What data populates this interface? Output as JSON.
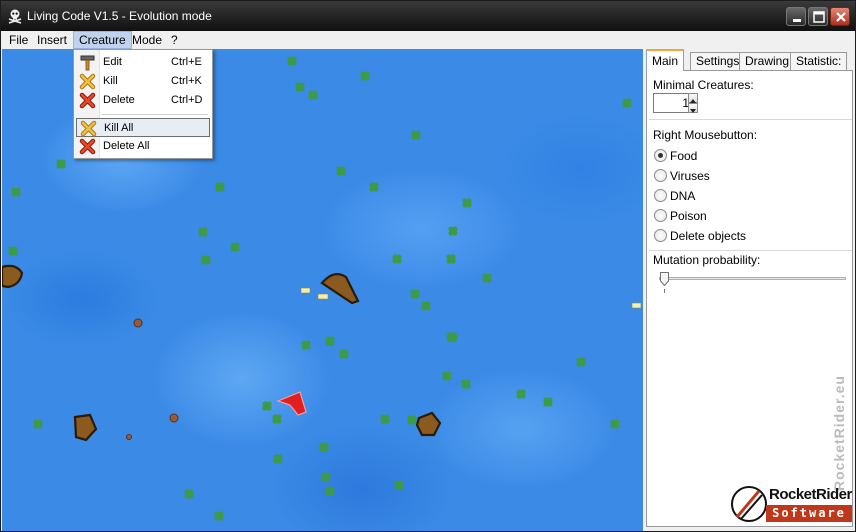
{
  "window": {
    "title": "Living Code V1.5 - Evolution mode",
    "icon": "skull-crossbones-icon"
  },
  "menubar": {
    "items": [
      {
        "label": "File"
      },
      {
        "label": "Insert"
      },
      {
        "label": "Creature",
        "active": true
      },
      {
        "label": "Mode"
      },
      {
        "label": "?"
      }
    ]
  },
  "creature_menu": {
    "items": [
      {
        "icon": "hammer-icon",
        "label": "Edit",
        "shortcut": "Ctrl+E"
      },
      {
        "icon": "kill-icon",
        "label": "Kill",
        "shortcut": "Ctrl+K"
      },
      {
        "icon": "delete-icon",
        "label": "Delete",
        "shortcut": "Ctrl+D"
      },
      {
        "icon": "kill-all-icon",
        "label": "Kill All",
        "shortcut": "",
        "hover": true
      },
      {
        "icon": "delete-all-icon",
        "label": "Delete All",
        "shortcut": ""
      }
    ]
  },
  "panel": {
    "tabs": [
      {
        "label": "Main",
        "selected": true
      },
      {
        "label": "Settings"
      },
      {
        "label": "Drawing"
      },
      {
        "label": "Statistic:"
      }
    ],
    "minimal_creatures_label": "Minimal Creatures:",
    "minimal_creatures_value": "1",
    "right_mouse_label": "Right Mousebutton:",
    "right_mouse_options": [
      {
        "label": "Food",
        "checked": true
      },
      {
        "label": "Viruses",
        "checked": false
      },
      {
        "label": "DNA",
        "checked": false
      },
      {
        "label": "Poison",
        "checked": false
      },
      {
        "label": "Delete objects",
        "checked": false
      }
    ],
    "mutation_label": "Mutation probability:",
    "mutation_value": 0,
    "watermark": "RocketRider.eu",
    "logo_line1": "RocketRider",
    "logo_line2": "Software"
  },
  "colors": {
    "water": "#3a8ae6",
    "food": "#3d9a48",
    "creature": "#8a5a1e",
    "creature_outline": "#2a1a08",
    "hunter": "#e02020",
    "accent_tab": "#f4a63a",
    "logo_red": "#c0381c"
  }
}
